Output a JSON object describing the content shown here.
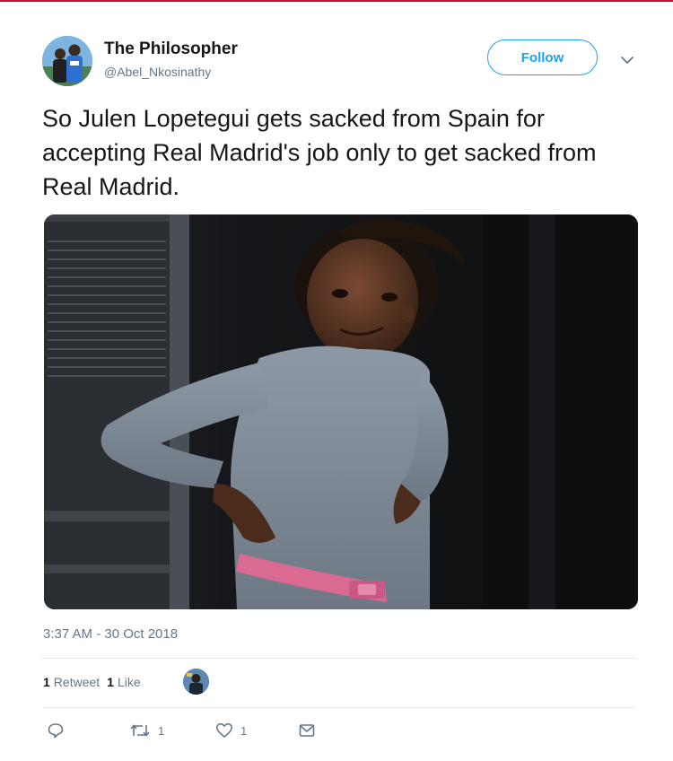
{
  "user": {
    "display_name": "The Philosopher",
    "handle": "@Abel_Nkosinathy"
  },
  "follow_label": "Follow",
  "tweet": {
    "text": "So Julen Lopetegui gets sacked from Spain for accepting Real Madrid's job only to get sacked from Real Madrid.",
    "timestamp": "3:37 AM - 30 Oct 2018"
  },
  "stats": {
    "retweets_count": "1",
    "retweets_label": "Retweet",
    "likes_count": "1",
    "likes_label": "Like"
  },
  "actions": {
    "retweet_count": "1",
    "like_count": "1"
  },
  "icons": {
    "more": "chevron-down-icon",
    "reply": "reply-icon",
    "retweet": "retweet-icon",
    "like": "heart-icon",
    "message": "envelope-icon"
  },
  "colors": {
    "accent": "#1da1f2",
    "muted": "#657786",
    "text": "#14171a",
    "divider": "#e6ecf0"
  }
}
